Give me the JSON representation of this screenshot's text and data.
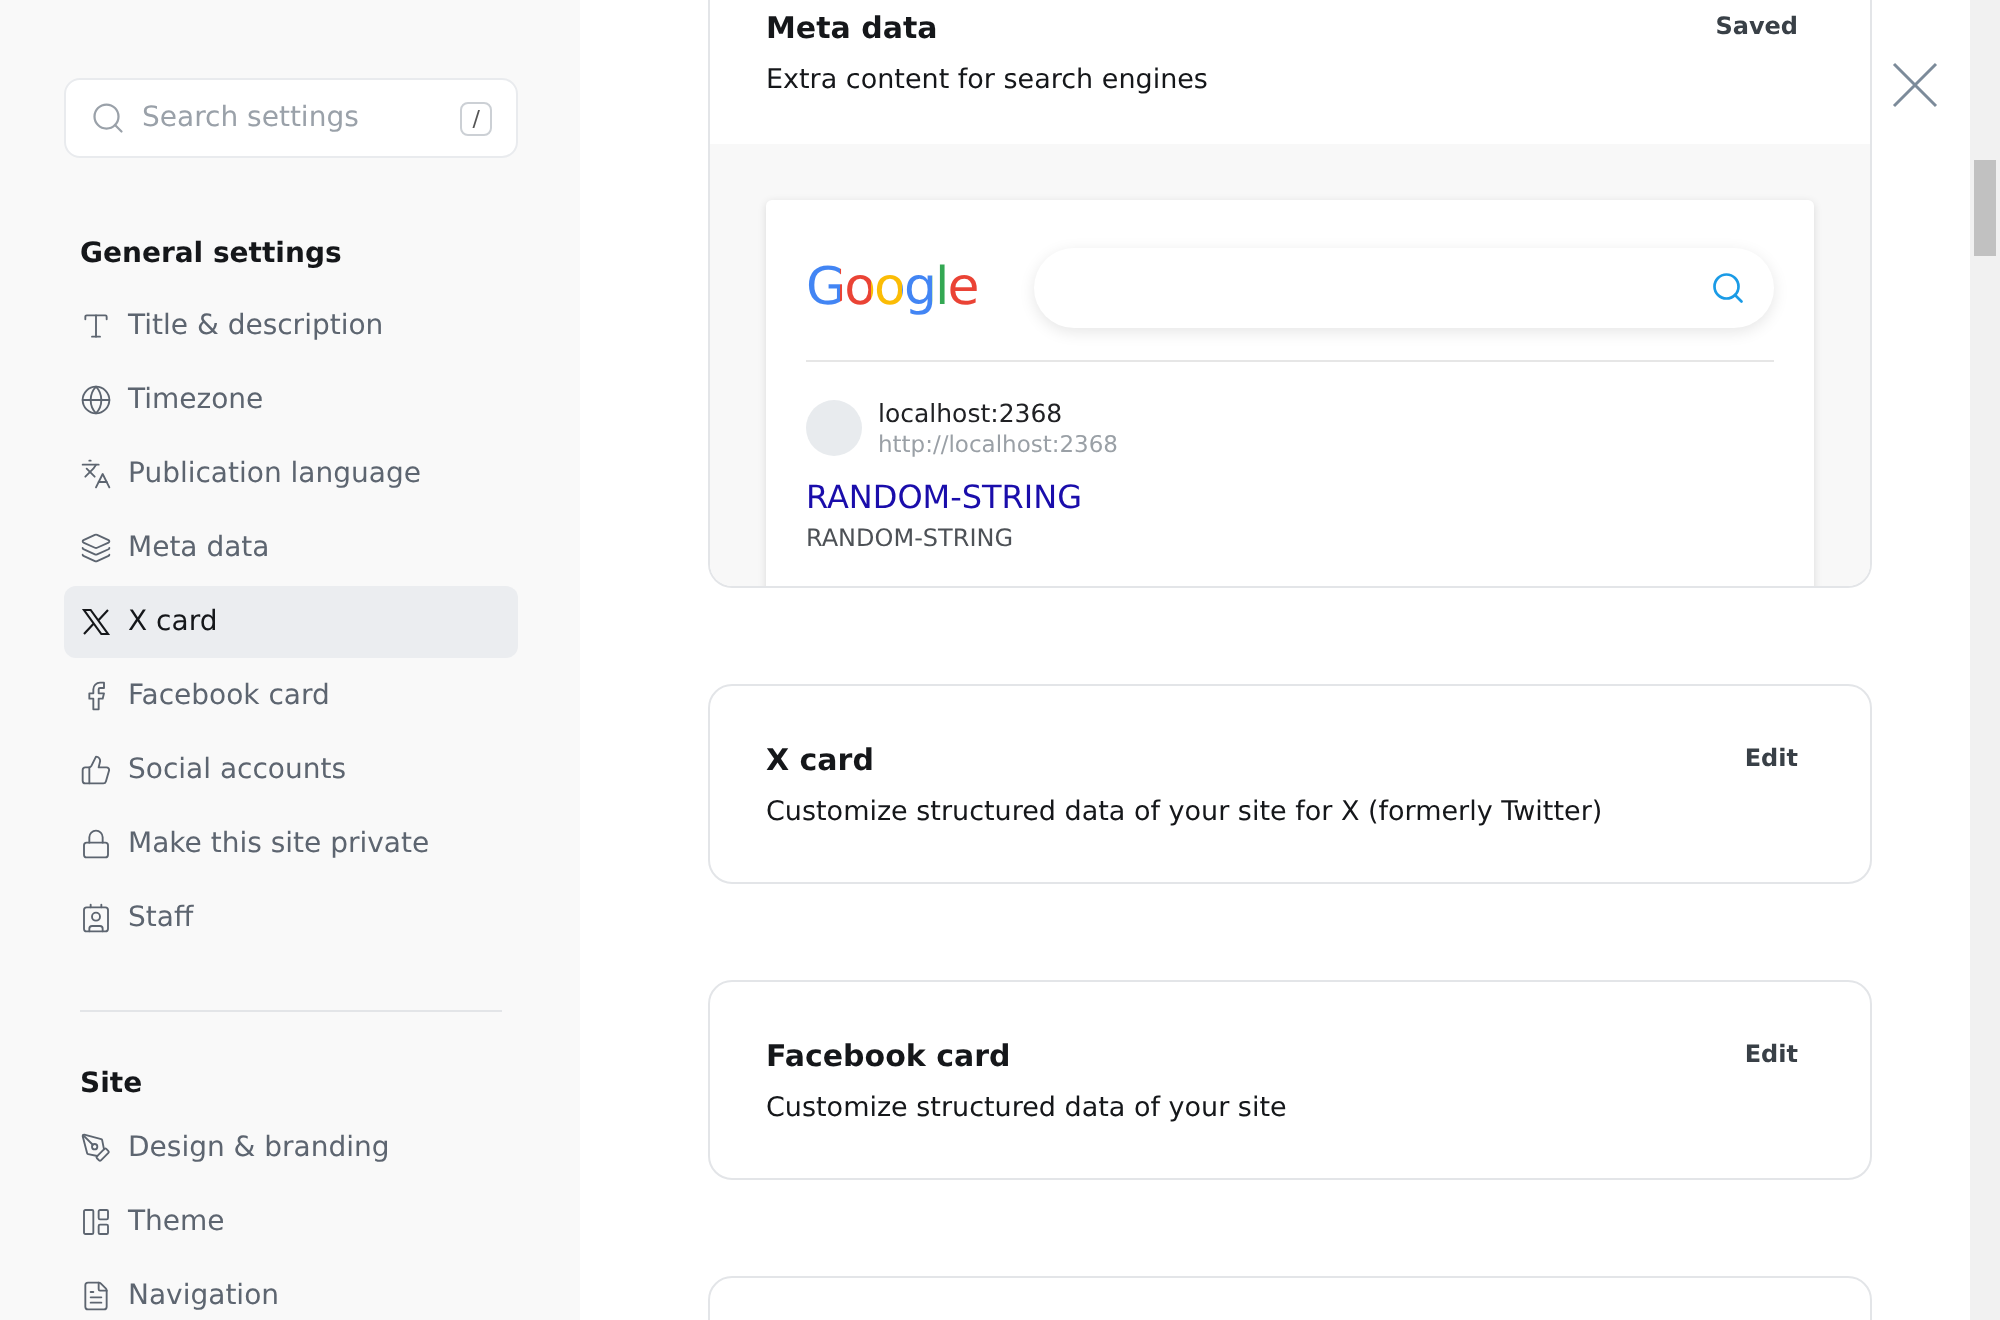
{
  "sidebar": {
    "search": {
      "placeholder": "Search settings",
      "shortcut": "/"
    },
    "sections": [
      {
        "title": "General settings",
        "items": [
          {
            "label": "Title & description",
            "selected": false
          },
          {
            "label": "Timezone",
            "selected": false
          },
          {
            "label": "Publication language",
            "selected": false
          },
          {
            "label": "Meta data",
            "selected": false
          },
          {
            "label": "X card",
            "selected": true
          },
          {
            "label": "Facebook card",
            "selected": false
          },
          {
            "label": "Social accounts",
            "selected": false
          },
          {
            "label": "Make this site private",
            "selected": false
          },
          {
            "label": "Staff",
            "selected": false
          }
        ]
      },
      {
        "title": "Site",
        "items": [
          {
            "label": "Design & branding",
            "selected": false
          },
          {
            "label": "Theme",
            "selected": false
          },
          {
            "label": "Navigation",
            "selected": false
          }
        ]
      }
    ]
  },
  "cards": [
    {
      "kind": "preview",
      "title": "Meta data",
      "subtitle": "Extra content for search engines",
      "action": "Saved",
      "preview": {
        "logo": "Google",
        "site_name": "localhost:2368",
        "url": "http://localhost:2368",
        "result_title": "RANDOM-STRING",
        "result_description": "RANDOM-STRING"
      }
    },
    {
      "kind": "plain",
      "title": "X card",
      "subtitle": "Customize structured data of your site for X (formerly Twitter)",
      "action": "Edit"
    },
    {
      "kind": "plain",
      "title": "Facebook card",
      "subtitle": "Customize structured data of your site",
      "action": "Edit"
    },
    {
      "kind": "empty"
    }
  ]
}
